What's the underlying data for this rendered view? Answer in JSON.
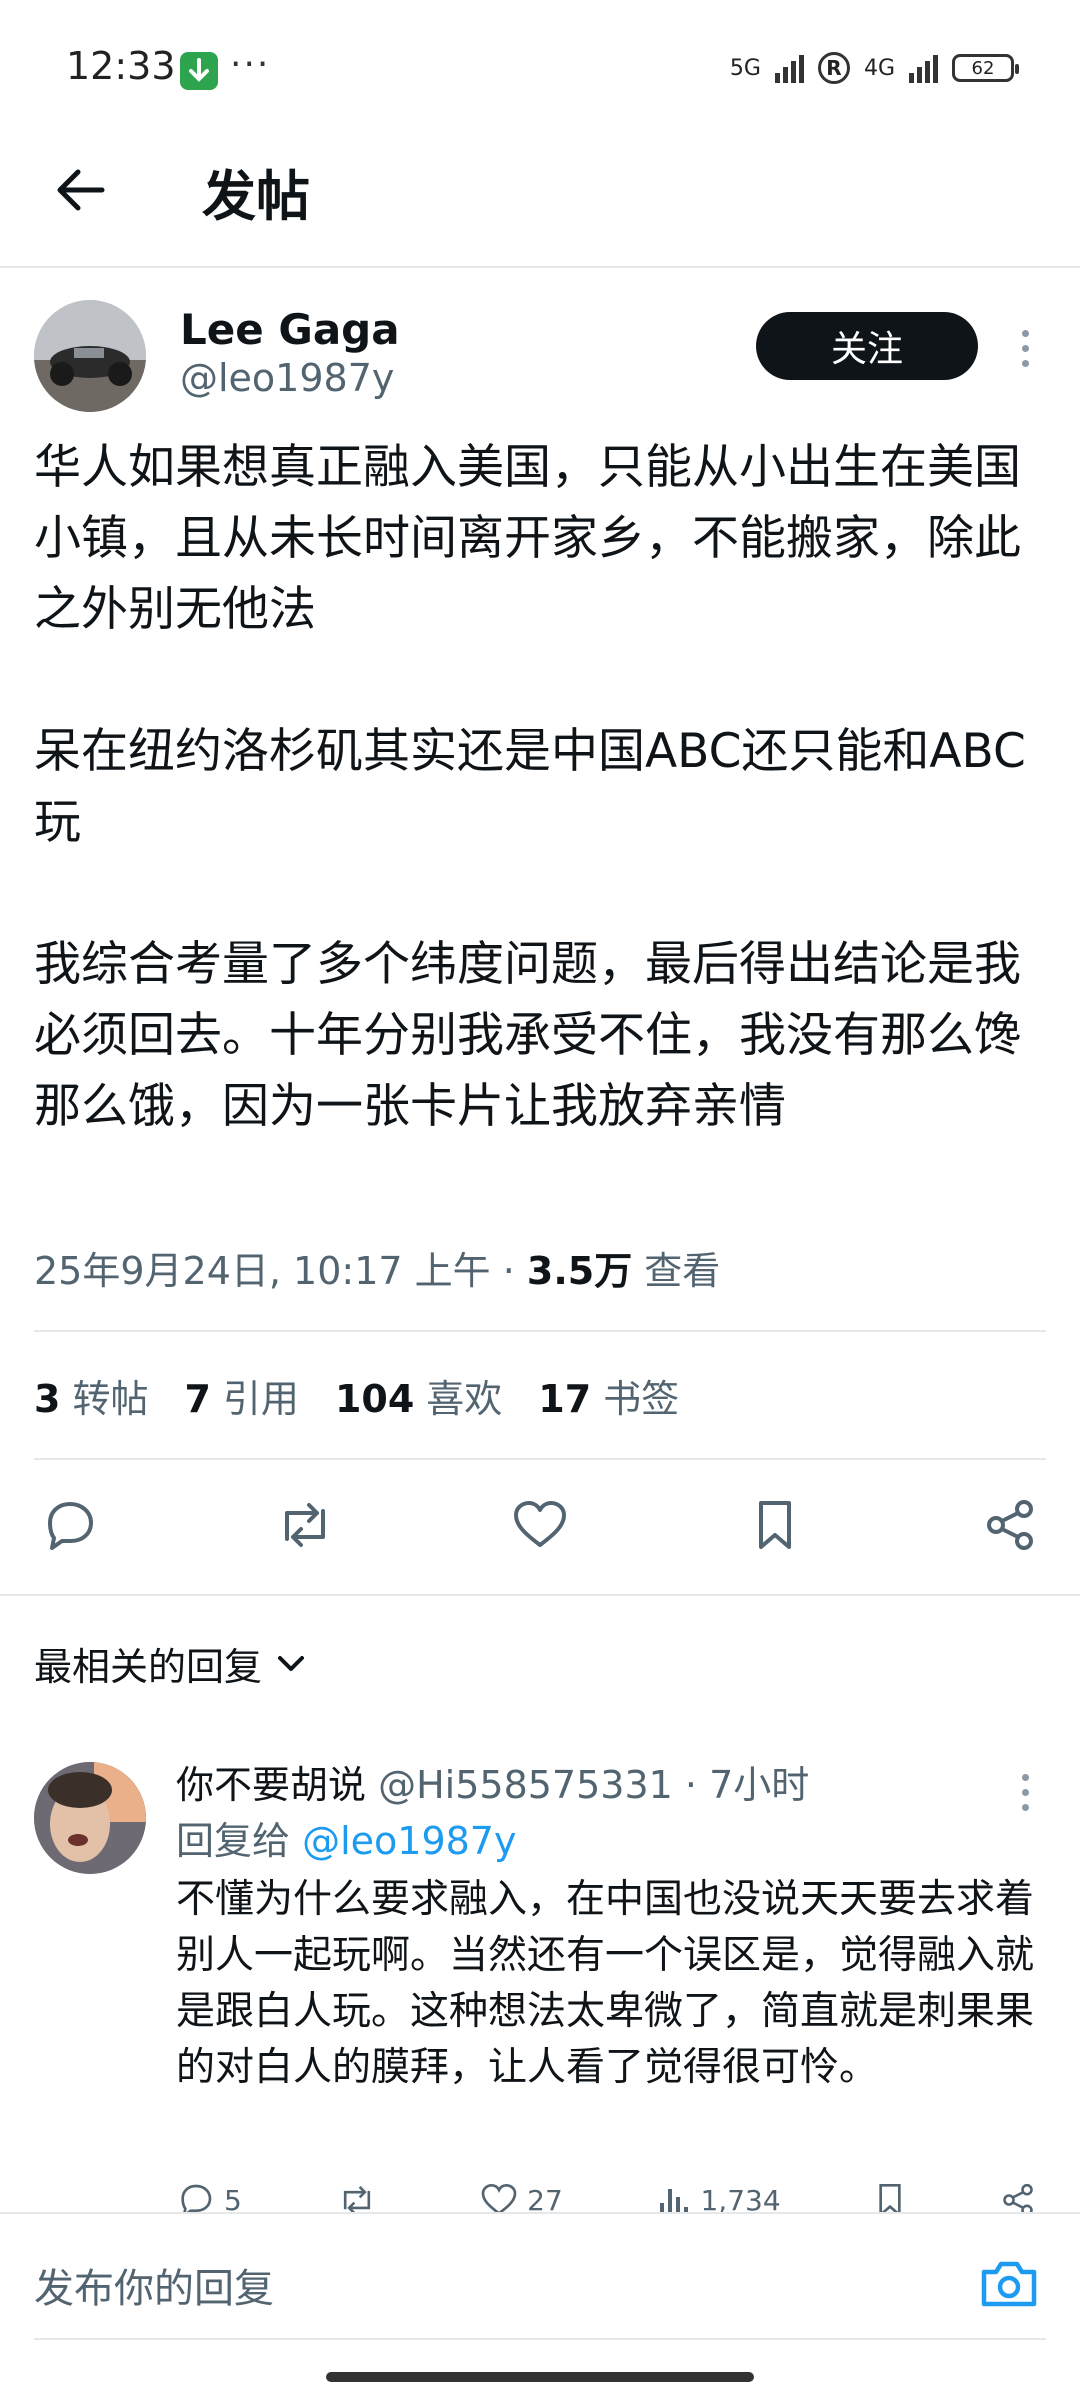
{
  "status_bar": {
    "time": "12:33",
    "dots": "···",
    "network1": "5G",
    "network2": "4G",
    "registered": "R",
    "battery": "62"
  },
  "header": {
    "title": "发帖"
  },
  "post": {
    "author_name": "Lee Gaga",
    "author_handle": "@leo1987y",
    "follow_label": "关注",
    "text": "华人如果想真正融入美国，只能从小出生在美国小镇，且从未长时间离开家乡，不能搬家，除此之外别无他法\n\n呆在纽约洛杉矶其实还是中国ABC还只能和ABC玩\n\n我综合考量了多个纬度问题，最后得出结论是我必须回去。十年分别我承受不住，我没有那么馋那么饿，因为一张卡片让我放弃亲情",
    "timestamp": "25年9月24日, 10:17 上午 · ",
    "views_count": "3.5万",
    "views_label": " 查看",
    "stats": {
      "reposts_count": "3",
      "reposts_label": "转帖",
      "quotes_count": "7",
      "quotes_label": "引用",
      "likes_count": "104",
      "likes_label": "喜欢",
      "bookmarks_count": "17",
      "bookmarks_label": "书签"
    }
  },
  "replies_section": {
    "sort_label": "最相关的回复"
  },
  "reply": {
    "name": "你不要胡说",
    "handle": " @Hi558575331",
    "time": " · 7小时",
    "reply_to_label": "回复给 ",
    "reply_to_handle": "@leo1987y",
    "text": "不懂为什么要求融入，在中国也没说天天要去求着别人一起玩啊。当然还有一个误区是，觉得融入就是跟白人玩。这种想法太卑微了，简直就是刺果果的对白人的膜拜，让人看了觉得很可怜。",
    "replies": "5",
    "reposts": "",
    "likes": "27",
    "views": "1,734"
  },
  "compose": {
    "placeholder": "发布你的回复"
  },
  "colors": {
    "accent": "#1d9bf0",
    "text": "#0f1419",
    "secondary": "#536471",
    "divider": "#e6e8ea"
  }
}
